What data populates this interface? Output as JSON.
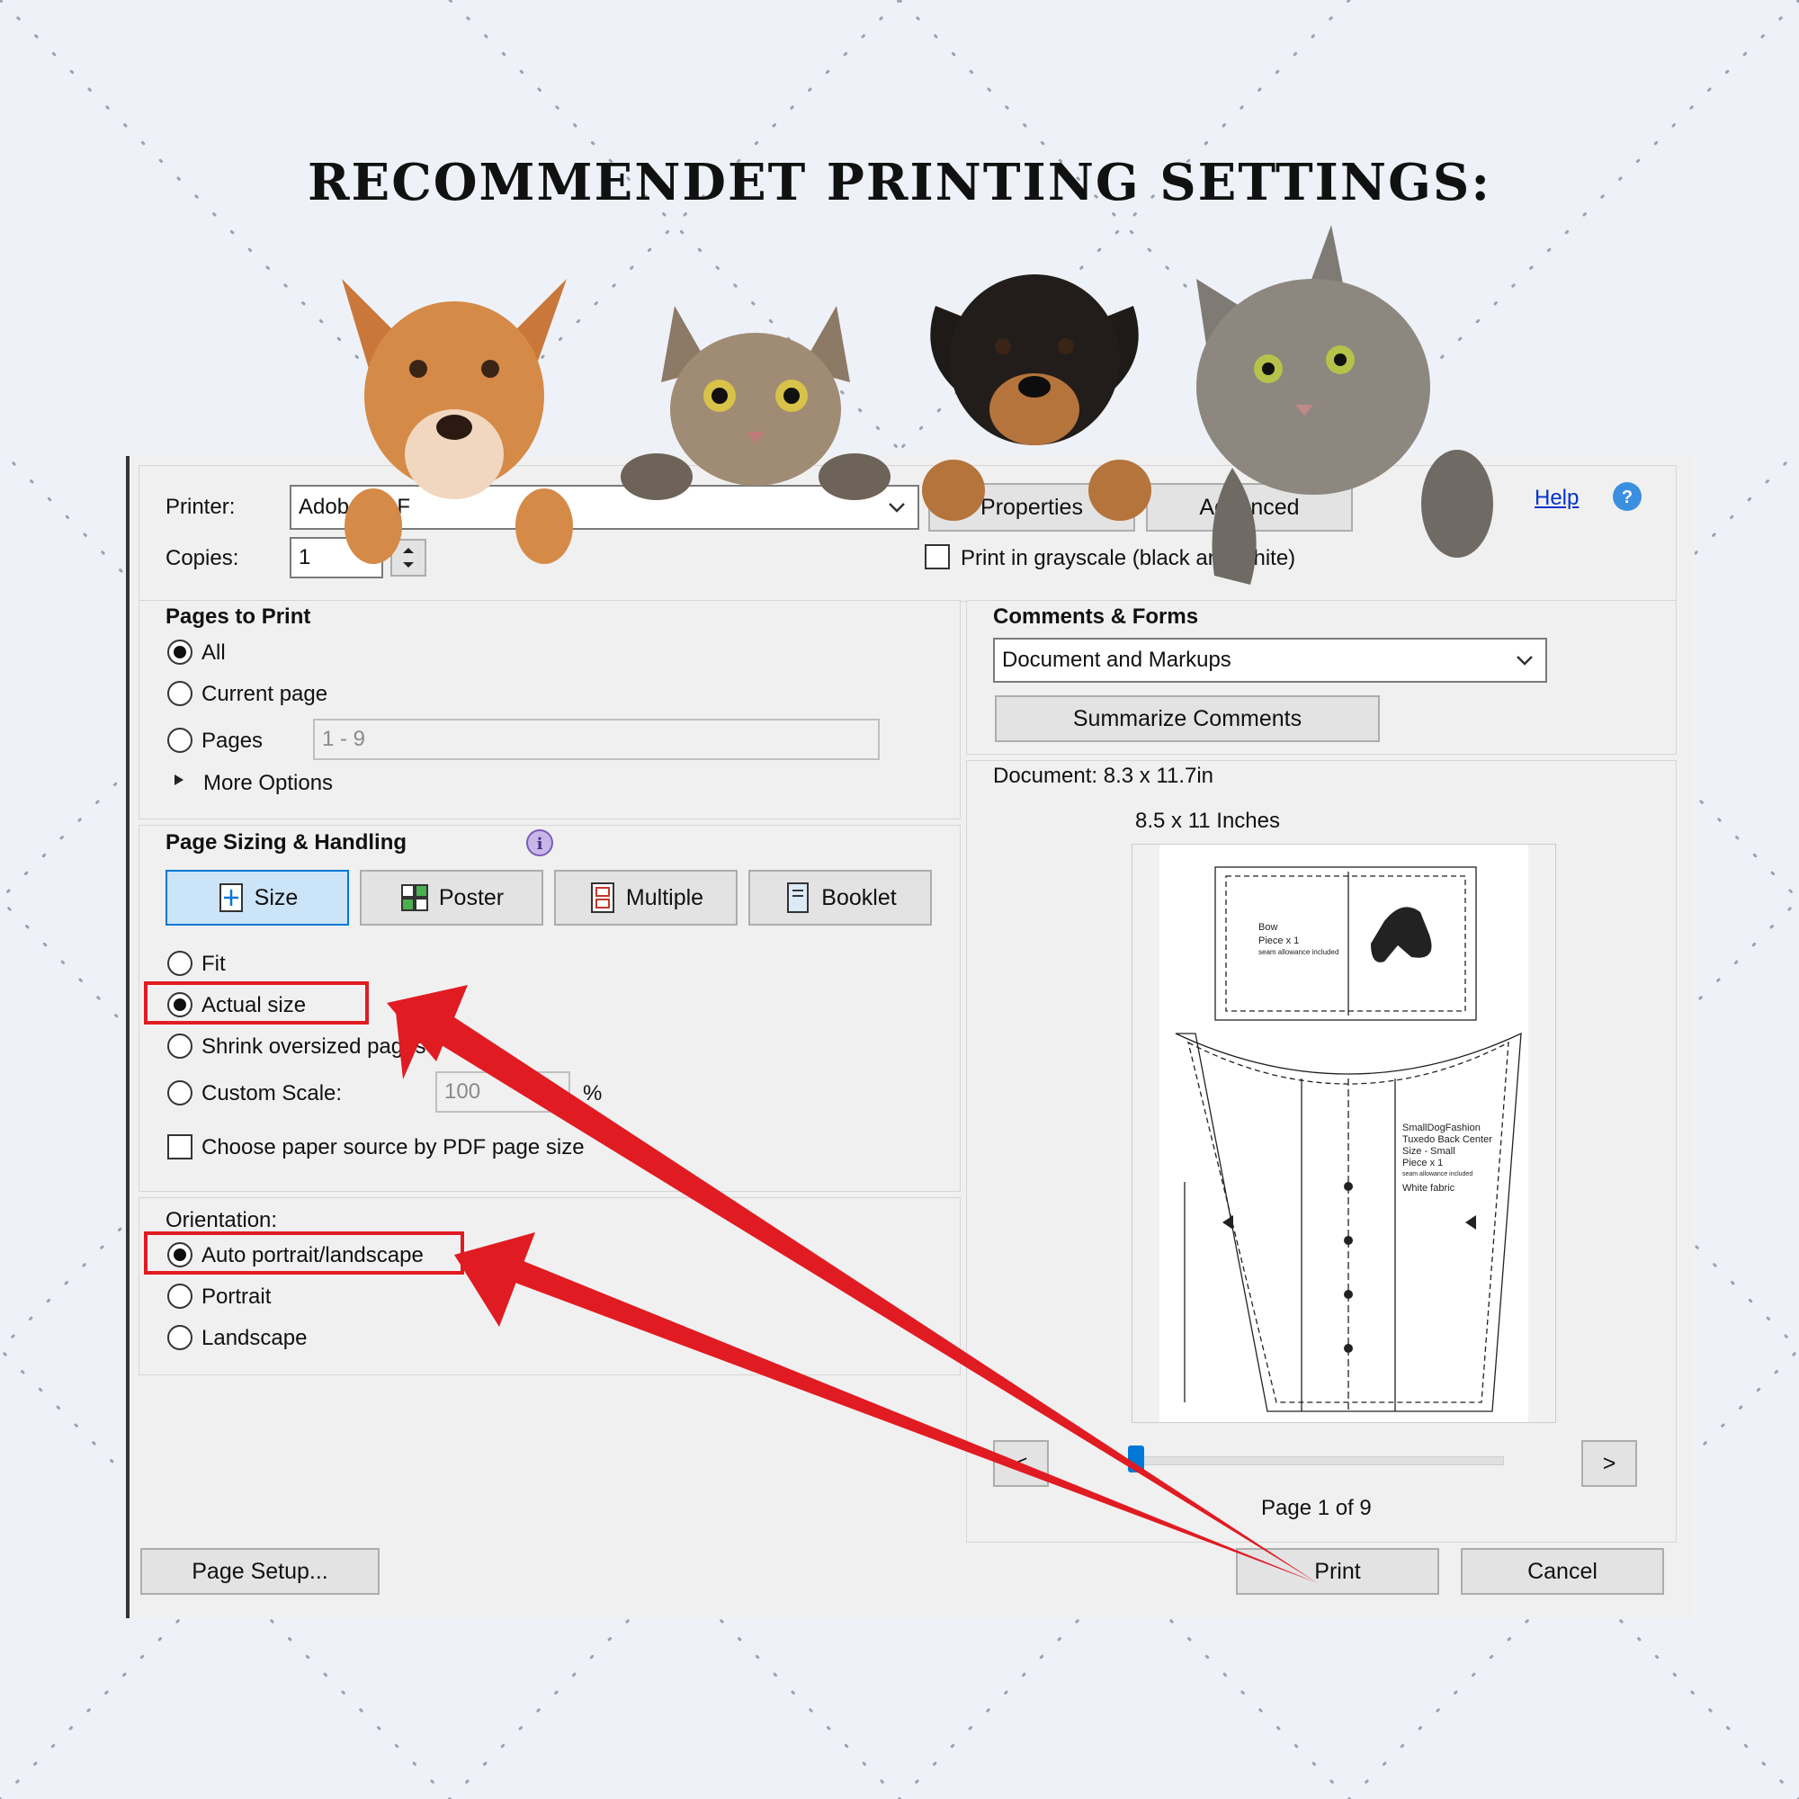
{
  "heading": "RECOMMENDET PRINTING SETTINGS:",
  "colors": {
    "accent": "#0078d7",
    "highlight": "#e11b22",
    "dialog_bg": "#f0f0f0"
  },
  "printer": {
    "label": "Printer:",
    "value": "Adobe PDF",
    "properties_label": "Properties",
    "advanced_label": "Advanced",
    "help_label": "Help",
    "copies_label": "Copies:",
    "copies_value": "1",
    "grayscale_label": "Print in grayscale (black and white)"
  },
  "pages_to_print": {
    "title": "Pages to Print",
    "options": [
      "All",
      "Current page",
      "Pages"
    ],
    "selected": "All",
    "pages_range_placeholder": "1 - 9",
    "more_options": "More Options"
  },
  "sizing": {
    "title": "Page Sizing & Handling",
    "modes": [
      "Size",
      "Poster",
      "Multiple",
      "Booklet"
    ],
    "active_mode": "Size",
    "options": [
      "Fit",
      "Actual size",
      "Shrink oversized pages",
      "Custom Scale:"
    ],
    "selected": "Actual size",
    "scale_value": "100",
    "scale_unit": "%",
    "paper_source": "Choose paper source by PDF page size"
  },
  "orientation": {
    "title": "Orientation:",
    "options": [
      "Auto portrait/landscape",
      "Portrait",
      "Landscape"
    ],
    "selected": "Auto portrait/landscape"
  },
  "comments": {
    "title": "Comments & Forms",
    "value": "Document and Markups",
    "summarize": "Summarize Comments"
  },
  "preview": {
    "document_size": "Document: 8.3 x 11.7in",
    "paper_size": "8.5 x 11 Inches",
    "page_status": "Page 1 of 9",
    "prev": "<",
    "next": ">",
    "page_current": 1,
    "page_total": 9,
    "pattern_text": {
      "bow": "Bow",
      "bow_piece": "Piece x 1",
      "bow_note": "seam allowance included",
      "piece2_lines": [
        "SmallDogFashion",
        "Tuxedo Back Center",
        "Size - Small",
        "Piece x 1",
        "seam allowance included",
        "White fabric"
      ]
    }
  },
  "footer": {
    "page_setup": "Page Setup...",
    "print": "Print",
    "cancel": "Cancel"
  }
}
